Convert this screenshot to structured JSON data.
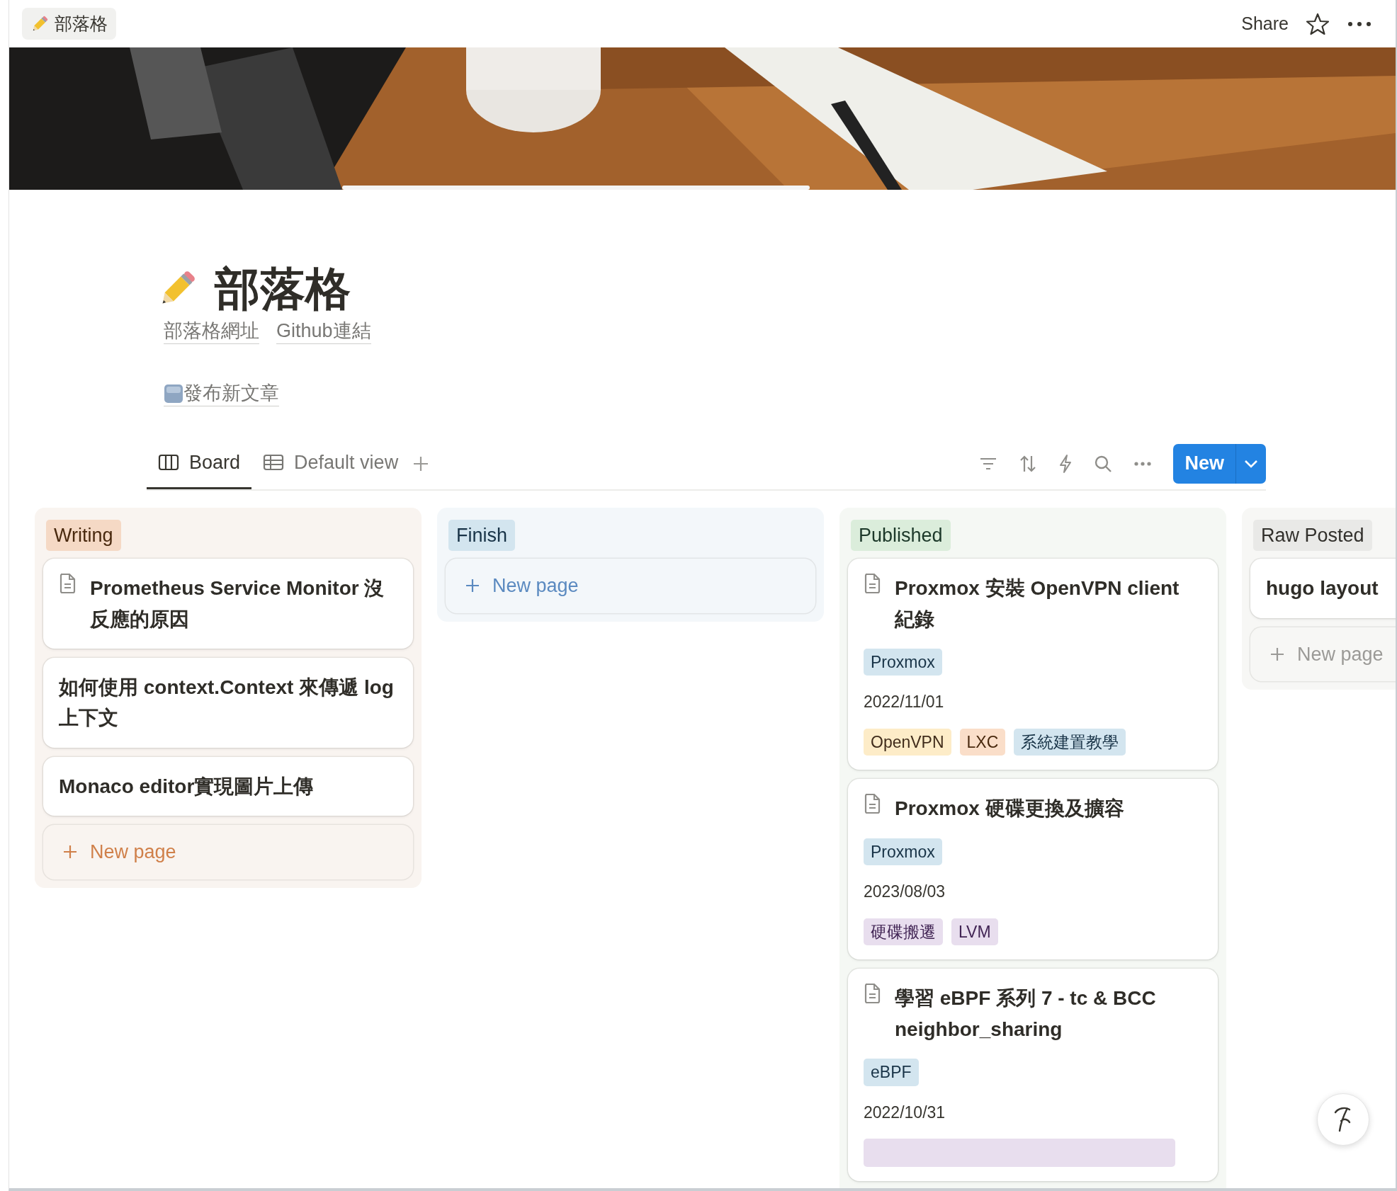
{
  "topbar": {
    "breadcrumb": "部落格",
    "share": "Share"
  },
  "page": {
    "title": "部落格",
    "links": [
      "部落格網址",
      "Github連結"
    ],
    "callout_link": "發布新文章"
  },
  "views": {
    "tabs": [
      {
        "label": "Board",
        "kind": "board",
        "selected": true
      },
      {
        "label": "Default view",
        "kind": "table",
        "selected": false
      }
    ],
    "new_button": "New"
  },
  "columns": [
    {
      "name": "Writing",
      "color": "#f5d9c5",
      "new_page": "New page",
      "cards": [
        {
          "title": "Prometheus Service Monitor 沒反應的原因",
          "icon": true
        },
        {
          "title": "如何使用 context.Context 來傳遞 log 上下文",
          "icon": false
        },
        {
          "title": "Monaco editor實現圖片上傳",
          "icon": false
        }
      ]
    },
    {
      "name": "Finish",
      "color": "#d3e5ef",
      "new_page": "New page"
    },
    {
      "name": "Published",
      "color": "#dbeddb",
      "cards": [
        {
          "title": "Proxmox 安裝 OpenVPN client 紀錄",
          "icon": true,
          "category": {
            "label": "Proxmox",
            "color": "#d3e5ef"
          },
          "date": "2022/11/01",
          "tags": [
            {
              "label": "OpenVPN",
              "color": "#fdecc8"
            },
            {
              "label": "LXC",
              "color": "#fadec9"
            },
            {
              "label": "系統建置教學",
              "color": "#d3e5ef"
            }
          ]
        },
        {
          "title": "Proxmox 硬碟更換及擴容",
          "icon": true,
          "category": {
            "label": "Proxmox",
            "color": "#d3e5ef"
          },
          "date": "2023/08/03",
          "tags": [
            {
              "label": "硬碟搬遷",
              "color": "#e8deee"
            },
            {
              "label": "LVM",
              "color": "#e8deee"
            }
          ]
        },
        {
          "title": "學習 eBPF 系列 7 - tc & BCC neighbor_sharing",
          "icon": true,
          "category": {
            "label": "eBPF",
            "color": "#d3e5ef"
          },
          "date": "2022/10/31",
          "cut_tag": {
            "color": "#e8deee"
          }
        }
      ]
    },
    {
      "name": "Raw Posted",
      "color": "#e9e9e7",
      "new_page": "New page",
      "cards": [
        {
          "title": "hugo layout",
          "icon": false
        }
      ]
    }
  ]
}
